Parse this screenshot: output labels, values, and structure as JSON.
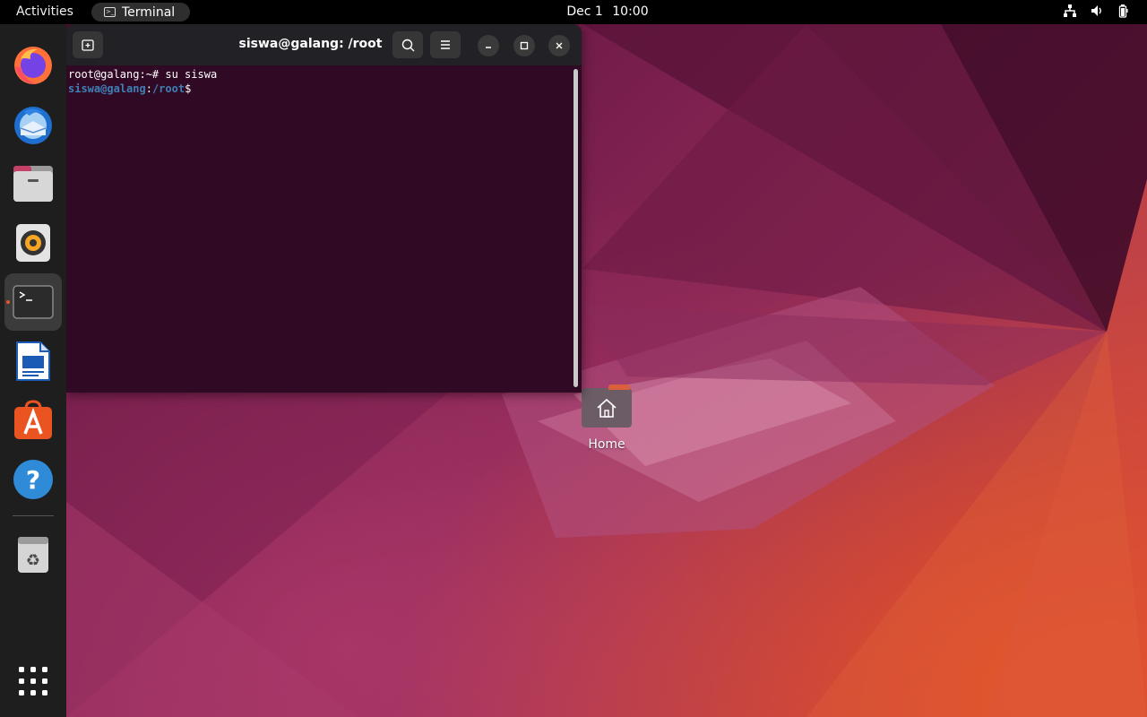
{
  "topbar": {
    "activities_label": "Activities",
    "active_app": "Terminal",
    "date": "Dec 1",
    "time": "10:00",
    "tray_icons": [
      "network-icon",
      "volume-icon",
      "battery-icon"
    ]
  },
  "dock": {
    "items": [
      {
        "name": "Firefox",
        "icon": "firefox-icon"
      },
      {
        "name": "Thunderbird",
        "icon": "thunderbird-icon"
      },
      {
        "name": "Files",
        "icon": "files-icon"
      },
      {
        "name": "Rhythmbox",
        "icon": "rhythmbox-icon"
      },
      {
        "name": "Terminal",
        "icon": "terminal-icon",
        "active": true
      },
      {
        "name": "LibreOffice Writer",
        "icon": "writer-icon"
      },
      {
        "name": "Ubuntu Software",
        "icon": "software-icon"
      },
      {
        "name": "Help",
        "icon": "help-icon"
      },
      {
        "name": "Trash",
        "icon": "trash-icon"
      },
      {
        "name": "Show Applications",
        "icon": "app-grid-icon"
      }
    ]
  },
  "terminal": {
    "title": "siswa@galang: /root",
    "lines": {
      "line1": "root@galang:~# su siswa",
      "prompt_user": "siswa@galang",
      "prompt_sep": ":",
      "prompt_path": "/root",
      "prompt_end": "$"
    }
  },
  "desktop": {
    "home_label": "Home"
  },
  "colors": {
    "accent": "#e95420",
    "terminal_bg": "#300a24",
    "prompt": "#3f7fb6"
  }
}
